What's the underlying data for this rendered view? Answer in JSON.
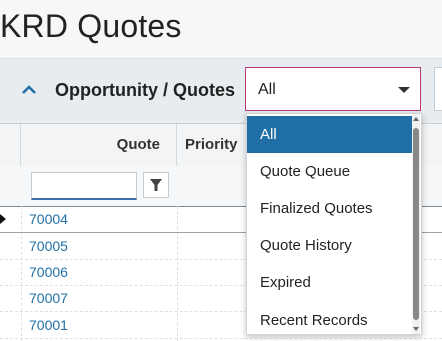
{
  "page": {
    "title": "KRD Quotes"
  },
  "section": {
    "title": "Opportunity / Quotes",
    "collapse_icon": "chevron-up-icon"
  },
  "filter_select": {
    "value": "All",
    "caret_icon": "caret-down-icon"
  },
  "grid": {
    "columns": [
      {
        "label": ""
      },
      {
        "label": "Quote"
      },
      {
        "label": "Priority"
      }
    ],
    "filter": {
      "value": "",
      "icon": "funnel-icon"
    },
    "rows": [
      {
        "quote": "70004",
        "selected": true
      },
      {
        "quote": "70005"
      },
      {
        "quote": "70006"
      },
      {
        "quote": "70007"
      },
      {
        "quote": "70001"
      }
    ]
  },
  "dropdown": {
    "selected_index": 0,
    "options": [
      {
        "label": "All"
      },
      {
        "label": "Quote Queue"
      },
      {
        "label": "Finalized Quotes"
      },
      {
        "label": "Quote History"
      },
      {
        "label": "Expired"
      },
      {
        "label": "Recent Records"
      }
    ]
  },
  "colors": {
    "accent": "#1f6fa6",
    "select_border": "#b83b7a",
    "header_bg": "#e6ecef"
  }
}
